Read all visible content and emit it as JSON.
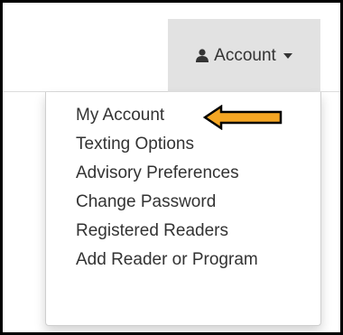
{
  "navbar": {
    "account_label": "Account",
    "user_icon": "user-icon",
    "caret_icon": "caret-down-icon"
  },
  "menu": {
    "items": [
      {
        "label": "My Account"
      },
      {
        "label": "Texting Options"
      },
      {
        "label": "Advisory Preferences"
      },
      {
        "label": "Change Password"
      },
      {
        "label": "Registered Readers"
      },
      {
        "label": "Add Reader or Program"
      }
    ]
  },
  "annotation": {
    "arrow_icon": "arrow-left-icon",
    "arrow_fill": "#f5a623",
    "arrow_stroke": "#000000"
  },
  "colors": {
    "toggle_bg": "#e2e2e2",
    "text": "#333333",
    "frame": "#000000"
  }
}
